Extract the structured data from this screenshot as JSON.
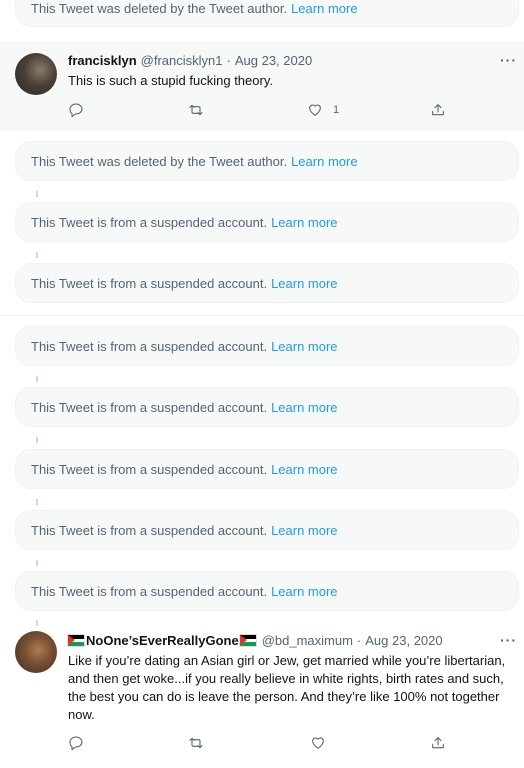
{
  "notices": {
    "deleted_text": "This Tweet was deleted by the Tweet author.",
    "suspended_text": "This Tweet is from a suspended account.",
    "learn_more": "Learn more"
  },
  "tweet1": {
    "name": "francisklyn",
    "handle": "@francisklyn1",
    "separator": "·",
    "date": "Aug 23, 2020",
    "text": "This is such a stupid fucking theory.",
    "more": "···",
    "likes": "1"
  },
  "tweet2": {
    "name": "NoOne’sEverReallyGone",
    "handle": "@bd_maximum",
    "separator": "·",
    "date": "Aug 23, 2020",
    "text": "Like if you’re dating an Asian girl or Jew, get married while you’re libertarian, and then get woke...if you really believe in white rights, birth rates and such, the best you  can do is leave the person. And they’re like 100% not together now.",
    "more": "···",
    "flag_icon": "palestine-flag-icon"
  },
  "colors": {
    "link": "#1d9bf0",
    "muted": "#536471",
    "notice_bg": "#f7f9f9"
  }
}
